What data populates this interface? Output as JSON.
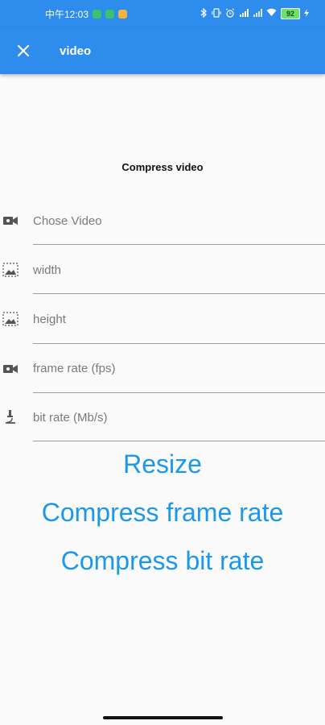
{
  "status_bar": {
    "time": "中午12:03",
    "battery": "92",
    "colors": {
      "background": "#2e8cec",
      "battery_fill": "#69e36e"
    }
  },
  "app_bar": {
    "title": "video",
    "close_icon": "close-icon",
    "background": "#2e8cec"
  },
  "form": {
    "heading": "Compress video",
    "fields": [
      {
        "icon": "videocam-icon",
        "placeholder": "Chose Video"
      },
      {
        "icon": "image-icon",
        "placeholder": "width"
      },
      {
        "icon": "image-icon",
        "placeholder": "height"
      },
      {
        "icon": "videocam-icon",
        "placeholder": "frame rate (fps)"
      },
      {
        "icon": "microscope-icon",
        "placeholder": "bit rate (Mb/s)"
      }
    ]
  },
  "actions": {
    "resize": "Resize",
    "compress_frame_rate": "Compress frame rate",
    "compress_bit_rate": "Compress bit rate",
    "color": "#1c98ea"
  }
}
